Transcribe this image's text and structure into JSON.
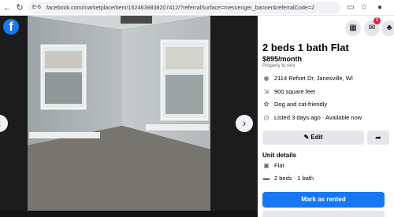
{
  "browser": {
    "site_badge": "E-6",
    "url": "facebook.com/marketplace/item/1624638838207412/?referralSurface=messenger_banner&referralCode=2"
  },
  "topbar": {
    "notification_count": "1"
  },
  "listing": {
    "title": "2 beds 1 bath Flat",
    "price": "$895/month",
    "subtype": "Property to rent",
    "address": "2114 Refset Dr, Janesville, WI",
    "size": "900 square feet",
    "pets": "Dog and cat-friendly",
    "listed": "Listed 3 days ago · Available now"
  },
  "actions": {
    "edit_label": "Edit",
    "primary_label": "Mark as rented"
  },
  "unit_details": {
    "heading": "Unit details",
    "type": "Flat",
    "rooms": "2 beds · 1 bath"
  },
  "colors": {
    "brand": "#1877f2",
    "badge": "#e41e3f"
  }
}
